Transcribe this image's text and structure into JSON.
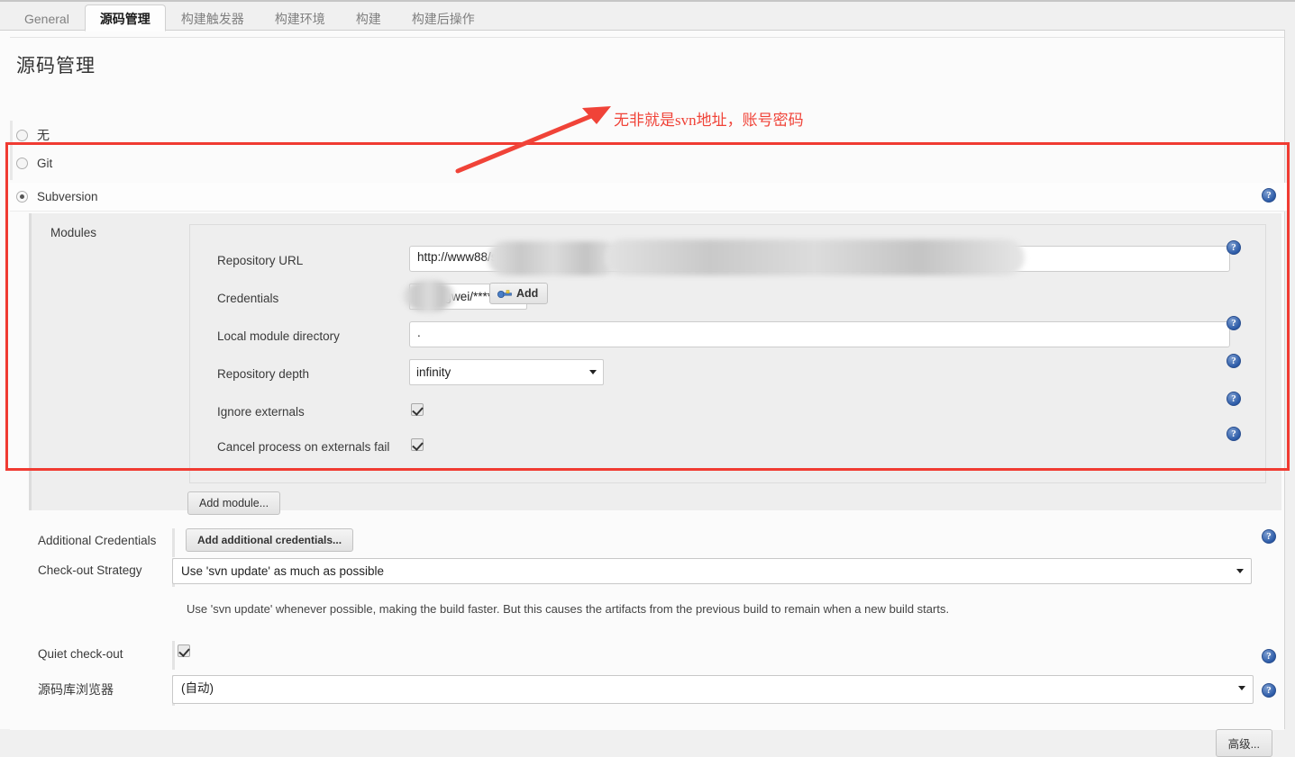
{
  "tabs": [
    {
      "label": "General",
      "active": false
    },
    {
      "label": "源码管理",
      "active": true
    },
    {
      "label": "构建触发器",
      "active": false
    },
    {
      "label": "构建环境",
      "active": false
    },
    {
      "label": "构建",
      "active": false
    },
    {
      "label": "构建后操作",
      "active": false
    }
  ],
  "page": {
    "section_title": "源码管理"
  },
  "annotation": {
    "text": "无非就是svn地址，账号密码",
    "color": "#f04338",
    "box_color": "#f03b32"
  },
  "scm_options": [
    {
      "label": "无",
      "selected": false
    },
    {
      "label": "Git",
      "selected": false
    },
    {
      "label": "Subversion",
      "selected": true
    }
  ],
  "modules": {
    "label": "Modules",
    "fields": {
      "repository_url": {
        "label": "Repository URL",
        "value_prefix": "http://www",
        "value_middle": "88/svn",
        "value_suffix": "/rc"
      },
      "credentials": {
        "label": "Credentials",
        "value": "ngwei/******",
        "add_button": "Add"
      },
      "local_module_directory": {
        "label": "Local module directory",
        "value": "."
      },
      "repository_depth": {
        "label": "Repository depth",
        "value": "infinity"
      },
      "ignore_externals": {
        "label": "Ignore externals",
        "checked": true
      },
      "cancel_process_on_externals_fail": {
        "label": "Cancel process on externals fail",
        "checked": true
      }
    },
    "add_module_button": "Add module..."
  },
  "additional_credentials": {
    "label": "Additional Credentials",
    "button": "Add additional credentials..."
  },
  "checkout_strategy": {
    "label": "Check-out Strategy",
    "value": "Use 'svn update' as much as possible",
    "description": "Use 'svn update' whenever possible, making the build faster. But this causes the artifacts from the previous build to remain when a new build starts."
  },
  "quiet_checkout": {
    "label": "Quiet check-out",
    "checked": true
  },
  "repository_browser": {
    "label": "源码库浏览器",
    "value": "(自动)"
  },
  "advanced_button": "高级...",
  "help_icon_glyph": "?"
}
